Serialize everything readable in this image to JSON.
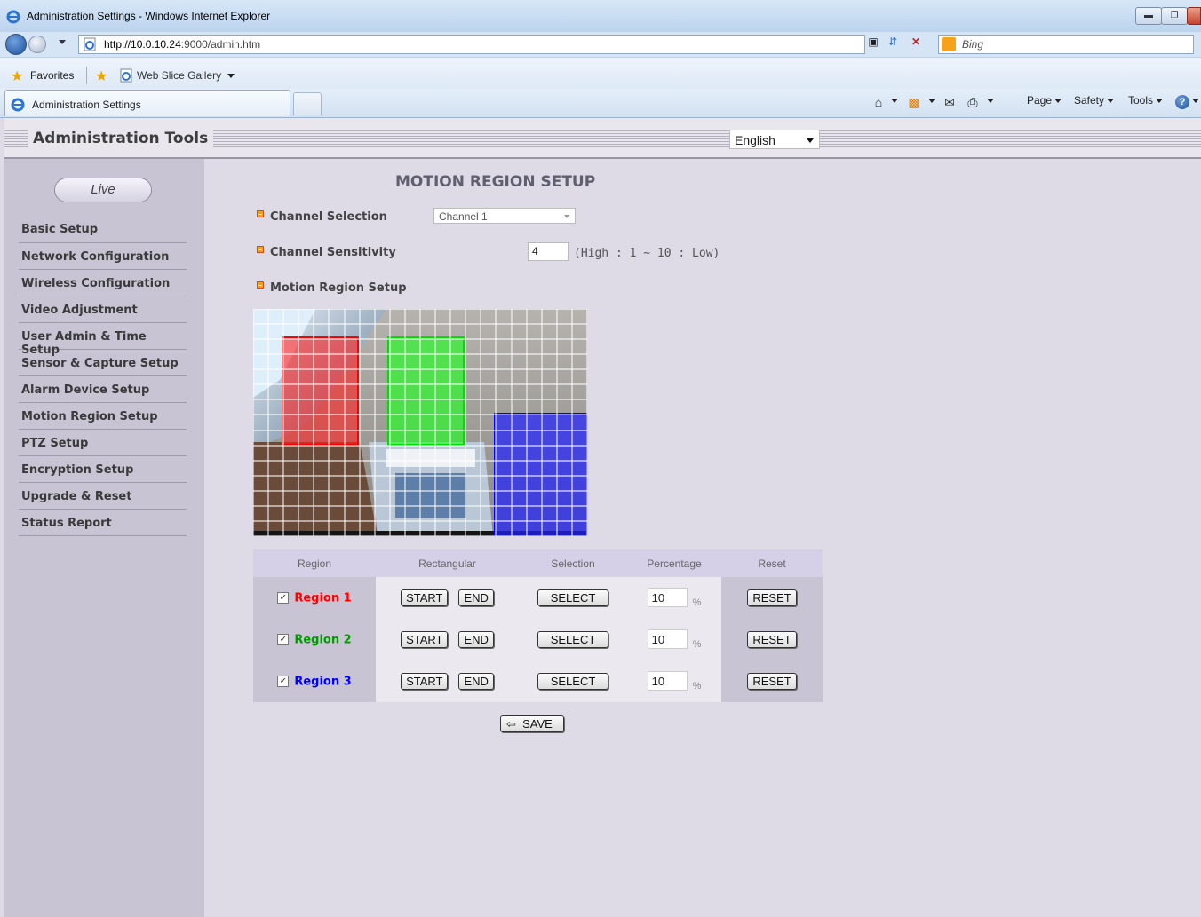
{
  "browser": {
    "window_title": "Administration Settings - Windows Internet Explorer",
    "url_host": "http://10.0.10.24",
    "url_rest": ":9000/admin.htm",
    "search_placeholder": "Bing",
    "favorites_label": "Favorites",
    "web_slice_label": "Web Slice Gallery",
    "tab_label": "Administration Settings",
    "commands": {
      "page": "Page",
      "safety": "Safety",
      "tools": "Tools"
    }
  },
  "header": {
    "title": "Administration Tools",
    "language": "English"
  },
  "sidebar": {
    "live_label": "Live",
    "items": [
      {
        "label": "Basic Setup"
      },
      {
        "label": "Network Configuration"
      },
      {
        "label": "Wireless Configuration"
      },
      {
        "label": "Video Adjustment"
      },
      {
        "label": "User Admin & Time Setup"
      },
      {
        "label": "Sensor & Capture Setup"
      },
      {
        "label": "Alarm Device Setup"
      },
      {
        "label": "Motion Region Setup"
      },
      {
        "label": "PTZ Setup"
      },
      {
        "label": "Encryption Setup"
      },
      {
        "label": "Upgrade & Reset"
      },
      {
        "label": "Status Report"
      }
    ]
  },
  "main": {
    "page_title": "MOTION REGION SETUP",
    "channel_selection_label": "Channel Selection",
    "channel_value": "Channel 1",
    "sensitivity_label": "Channel Sensitivity",
    "sensitivity_value": "4",
    "sensitivity_hint": "(High : 1 ~ 10 : Low)",
    "motion_region_label": "Motion Region Setup"
  },
  "table": {
    "headers": [
      "Region",
      "Rectangular",
      "Selection",
      "Percentage",
      "Reset"
    ],
    "start_label": "START",
    "end_label": "END",
    "select_label": "SELECT",
    "reset_label": "RESET",
    "percent_sign": "%",
    "rows": [
      {
        "name": "Region 1",
        "color": "#ff0000",
        "checked": true,
        "percentage": "10"
      },
      {
        "name": "Region 2",
        "color": "#009900",
        "checked": true,
        "percentage": "10"
      },
      {
        "name": "Region 3",
        "color": "#0000ff",
        "checked": true,
        "percentage": "10"
      }
    ]
  },
  "save_label": "SAVE"
}
